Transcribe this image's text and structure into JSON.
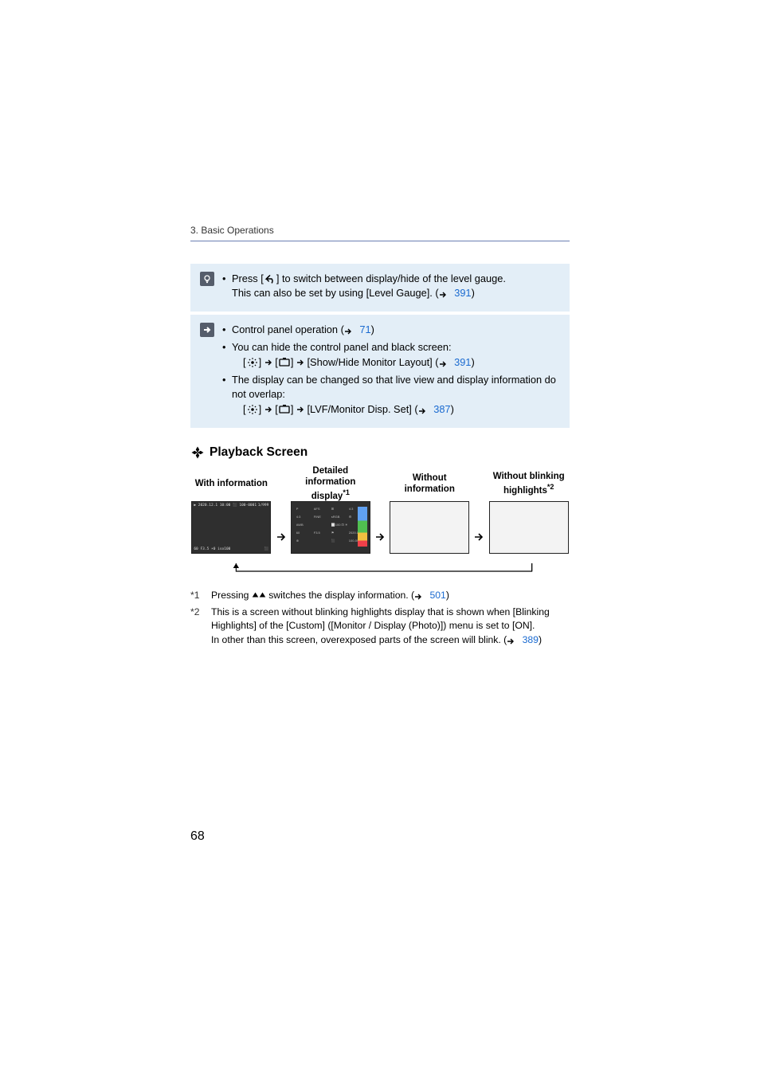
{
  "breadcrumb": "3. Basic Operations",
  "info_box_1": {
    "line1_a": "Press [",
    "line1_b": "] to switch between display/hide of the level gauge.",
    "line2_a": "This can also be set by using [Level Gauge]. (",
    "line2_link": "391",
    "line2_b": ")"
  },
  "info_box_2": {
    "b1_a": "Control panel operation (",
    "b1_link": "71",
    "b1_b": ")",
    "b2": "You can hide the control panel and black screen:",
    "b2_sub_a": "[",
    "b2_sub_b": "] ",
    "b2_sub_c": " [",
    "b2_sub_d": "] ",
    "b2_sub_e": " [Show/Hide Monitor Layout] (",
    "b2_sub_link": "391",
    "b2_sub_f": ")",
    "b3": "The display can be changed so that live view and display information do not overlap:",
    "b3_sub_a": "[",
    "b3_sub_b": "] ",
    "b3_sub_c": " [",
    "b3_sub_d": "] ",
    "b3_sub_e": " [LVF/Monitor Disp. Set] (",
    "b3_sub_link": "387",
    "b3_sub_f": ")"
  },
  "section_title": "Playback Screen",
  "screens": {
    "col1": "With information",
    "col2_a": "Detailed information display",
    "col2_sup": "*1",
    "col3": "Without information",
    "col4_a": "Without blinking highlights",
    "col4_sup": "*2",
    "s1_top_left": "▶ 2020.12.1 10:00 ⬛ 100-0001",
    "s1_top_right": "1/999",
    "s1_bot_left": "60  F3.5 ☀0  iso100",
    "s1_bot_right": "⬛",
    "s2_cells": [
      "P",
      "AFS",
      "⊞",
      "4:3",
      "4:3",
      "FINE",
      "sRGB",
      "⚙",
      "AWB",
      "",
      "⬜100 ⊡ ☀0",
      "",
      "60",
      "F3.5",
      "⚑",
      "2020.12.1 10:00",
      "⊕",
      "",
      "⬛",
      "100-0001",
      "",
      ""
    ]
  },
  "footnotes": {
    "f1_mark": "*1",
    "f1_a": "Pressing ",
    "f1_b": " switches the display information. (",
    "f1_link": "501",
    "f1_c": ")",
    "f2_mark": "*2",
    "f2_a": "This is a screen without blinking highlights display that is shown when [Blinking Highlights] of the [Custom] ([Monitor / Display (Photo)]) menu is set to [ON].",
    "f2_b": "In other than this screen, overexposed parts of the screen will blink. (",
    "f2_link": "389",
    "f2_c": ")"
  },
  "page_number": "68",
  "arrow_glyph": "➔"
}
